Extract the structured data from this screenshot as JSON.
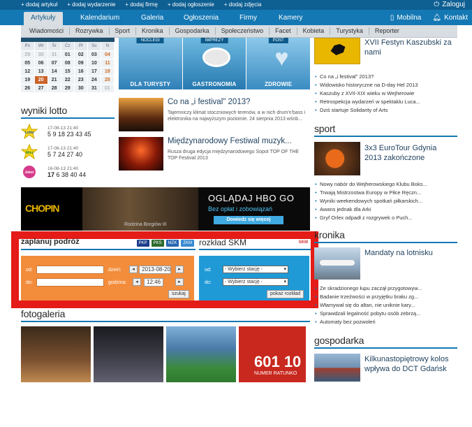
{
  "topbar": {
    "quick_links": [
      "+ dodaj artykuł",
      "+ dodaj wydarzenie",
      "+ dodaj firmę",
      "+ dodaj ogłoszenie",
      "+ dodaj zdjęcia"
    ],
    "login": "Zaloguj"
  },
  "mainnav": {
    "tabs": [
      "Artykuły",
      "Kalendarium",
      "Galeria",
      "Ogłoszenia",
      "Firmy",
      "Kamery"
    ],
    "mobile": "Mobilna",
    "contact": "Kontakt"
  },
  "subnav": [
    "Wiadomości",
    "Rozrywka",
    "Sport",
    "Kronika",
    "Gospodarka",
    "Społeczeństwo",
    "Facet",
    "Kobieta",
    "Turystyka",
    "Reporter"
  ],
  "calendar": {
    "days": [
      "Pn",
      "Wt",
      "Śr",
      "Cz",
      "Pt",
      "So",
      "N"
    ],
    "weeks": [
      [
        "29",
        "30",
        "31",
        "01",
        "02",
        "03",
        "04"
      ],
      [
        "05",
        "06",
        "07",
        "08",
        "09",
        "10",
        "11"
      ],
      [
        "12",
        "13",
        "14",
        "15",
        "16",
        "17",
        "18"
      ],
      [
        "19",
        "20",
        "21",
        "22",
        "23",
        "24",
        "25"
      ],
      [
        "26",
        "27",
        "28",
        "29",
        "30",
        "31",
        "01"
      ]
    ],
    "today": "20"
  },
  "tiles": [
    {
      "label": "NOCLEGI",
      "caption": "DLA TURYSTY"
    },
    {
      "label": "IMPREZY",
      "caption": "GASTRONOMIA"
    },
    {
      "label": "POST",
      "caption": "ZDROWIE"
    }
  ],
  "news": [
    {
      "title": "Co na „i festival\" 2013?",
      "desc": "Tajemniczy klimat stoczniowych terenów, a w nich drum'n'bass i elektronika na najwyższym poziomie. 24 sierpnia 2013 wśnb..."
    },
    {
      "title": "Międzynarodowy Festiwal muzyk...",
      "desc": "Rusza druga edycja międzynarodowego Sopot TOP OF THE TOP Festival 2013"
    }
  ],
  "lotto": {
    "title": "wyniki lotto",
    "results": [
      {
        "game": "Lotto",
        "date": "17-08-13 21:40",
        "numbers": "5 9 18 23 43 45"
      },
      {
        "game": "Mini",
        "date": "17-08-13 21:40",
        "numbers": "5 7 24 27 40"
      },
      {
        "game": "Joker",
        "date": "16-08-13 21:40",
        "numbers_bold": "17",
        "numbers": "6 38 40 44"
      }
    ]
  },
  "banner": {
    "chopin": "CHOPIN",
    "caption": "Rodzina Borgiów III",
    "hbo_title": "OGLĄDAJ HBO GO",
    "hbo_sub": "Bez opłat i zobowiązań",
    "hbo_btn": "Dowiedz się więcej"
  },
  "planner": {
    "title": "zaplanuj podróż",
    "from_label": "od:",
    "to_label": "do:",
    "date_label": "dzień:",
    "date_value": "2013-08-20",
    "time_label": "godzina:",
    "time_value": "12:46",
    "search_btn": "szukaj",
    "logos": [
      "PKP",
      "PKS",
      "MZK",
      "ZKM"
    ]
  },
  "skm": {
    "title": "rozkład SKM",
    "from_label": "od:",
    "to_label": "do:",
    "select_placeholder": "- Wybierz stację -",
    "show_btn": "pokaż rozkład",
    "logo": "SKM"
  },
  "gallery": {
    "title": "fotogaleria",
    "image4_text": "601 10",
    "image4_sub": "NUMER RATUNKO"
  },
  "right": {
    "festyn_title": "XVII Festyn Kaszubski za nami",
    "list1": [
      "Co na „i festival\" 2013?",
      "Widowisko historyczne na D-day Hel 2013",
      "Kaszuby z XVII-XIX wieku w Wejherowie",
      "Retrospekcja wydarzeń w spektaklu Luca...",
      "Dziś startuje Solidarity of Arts"
    ],
    "sport_title": "sport",
    "sport_news": "3x3 EuroTour Gdynia 2013 zakończone",
    "sport_list": [
      "Nowy nabór do Wejherowskiego Klubu Boks...",
      "Trwają Mistrzostwa Europy w Piłce Ręczn...",
      "Wyniki weekendowych spotkań piłkarskich...",
      "Awans jednak dla Arki",
      "Gryf Orlex odpadł z rozgrywek o Puch..."
    ],
    "kronika_title": "kronika",
    "kronika_news": "Mandaty na lotnisku",
    "kronika_list": [
      "Ze skradzionego łupu zaczął przygotowyw...",
      "Badanie trzeźwości w przyjętku braku zg...",
      "Włamywał się do altan, nie uniknie kary...",
      "Sprawdzali legalność pobytu osób zebrzą...",
      "Automaty bez pozwoleń"
    ],
    "gospodarka_title": "gospodarka",
    "gospodarka_news": "Kilkunastopiętrowy kolos wpływa do DCT Gdańsk"
  }
}
